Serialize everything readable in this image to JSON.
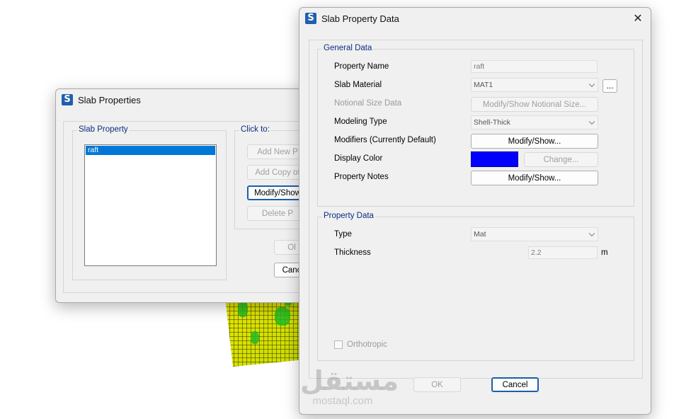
{
  "slab_properties": {
    "title": "Slab Properties",
    "group_title": "Slab Property",
    "list_items": [
      "raft"
    ],
    "click_to_title": "Click to:",
    "add_new_label": "Add New P",
    "add_copy_label": "Add Copy of",
    "modify_show_label": "Modify/Show",
    "delete_label": "Delete P",
    "ok_label": "Ol",
    "cancel_label": "Canc"
  },
  "slab_property_data": {
    "title": "Slab Property Data",
    "close_icon": "close-icon",
    "general_data": {
      "title": "General Data",
      "property_name_label": "Property Name",
      "property_name_value": "raft",
      "slab_material_label": "Slab Material",
      "slab_material_value": "MAT1",
      "ellipsis_label": "...",
      "notional_size_label": "Notional Size Data",
      "notional_size_button": "Modify/Show Notional Size...",
      "modeling_type_label": "Modeling Type",
      "modeling_type_value": "Shell-Thick",
      "modifiers_label": "Modifiers (Currently Default)",
      "modifiers_button": "Modify/Show...",
      "display_color_label": "Display Color",
      "display_color_value": "#0000ff",
      "change_button": "Change...",
      "property_notes_label": "Property Notes",
      "property_notes_button": "Modify/Show..."
    },
    "property_data": {
      "title": "Property Data",
      "type_label": "Type",
      "type_value": "Mat",
      "thickness_label": "Thickness",
      "thickness_value": "2.2",
      "thickness_unit": "m",
      "orthotropic_label": "Orthotropic",
      "orthotropic_checked": false
    },
    "ok_label": "OK",
    "cancel_label": "Cancel"
  },
  "watermark": {
    "arabic": "مستقل",
    "latin": "mostaql.com"
  }
}
